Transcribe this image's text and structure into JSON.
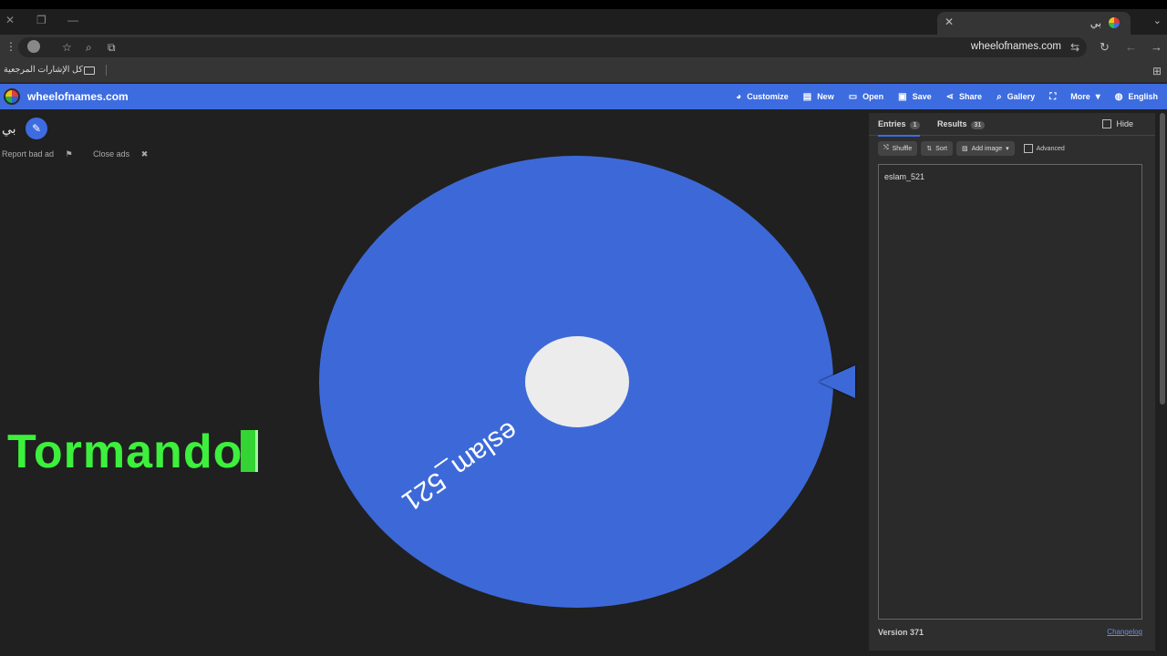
{
  "browser": {
    "tab_title": "بي",
    "tab_close": "✕",
    "new_tab": "+",
    "tab_menu": "⌄",
    "win_close": "✕",
    "win_restore": "❐",
    "win_min": "—",
    "url": "wheelofnames.com",
    "bookmarks_label": "كل الإشارات المرجعية",
    "icons": [
      "kebab-menu-icon",
      "profile-icon",
      "star-icon",
      "zoom-icon",
      "translate-icon",
      "site-settings-icon",
      "reload-icon",
      "back-icon",
      "forward-icon"
    ]
  },
  "site": {
    "name": "wheelofnames.com",
    "nav": [
      {
        "label": "Customize",
        "icon": "palette-icon"
      },
      {
        "label": "New",
        "icon": "file-icon"
      },
      {
        "label": "Open",
        "icon": "folder-icon"
      },
      {
        "label": "Save",
        "icon": "save-icon"
      },
      {
        "label": "Share",
        "icon": "share-icon"
      },
      {
        "label": "Gallery",
        "icon": "search-icon"
      },
      {
        "label": "",
        "icon": "fullscreen-icon"
      },
      {
        "label": "More",
        "icon": "caret-down-icon"
      },
      {
        "label": "English",
        "icon": "globe-icon"
      }
    ]
  },
  "left": {
    "title": "بي",
    "report_ad": "Report bad ad",
    "close_ads": "Close ads",
    "overlay_text": "Tormando"
  },
  "wheel": {
    "entry_label": "eslam_521",
    "color": "#3d69d8",
    "hub_color": "#ececec"
  },
  "panel": {
    "entries_tab": "Entries",
    "entries_count": "1",
    "results_tab": "Results",
    "results_count": "31",
    "hide_label": "Hide",
    "shuffle": "Shuffle",
    "sort": "Sort",
    "add_image": "Add image",
    "advanced": "Advanced",
    "entries_text": "eslam_521",
    "version": "Version 371",
    "changelog": "Changelog"
  }
}
